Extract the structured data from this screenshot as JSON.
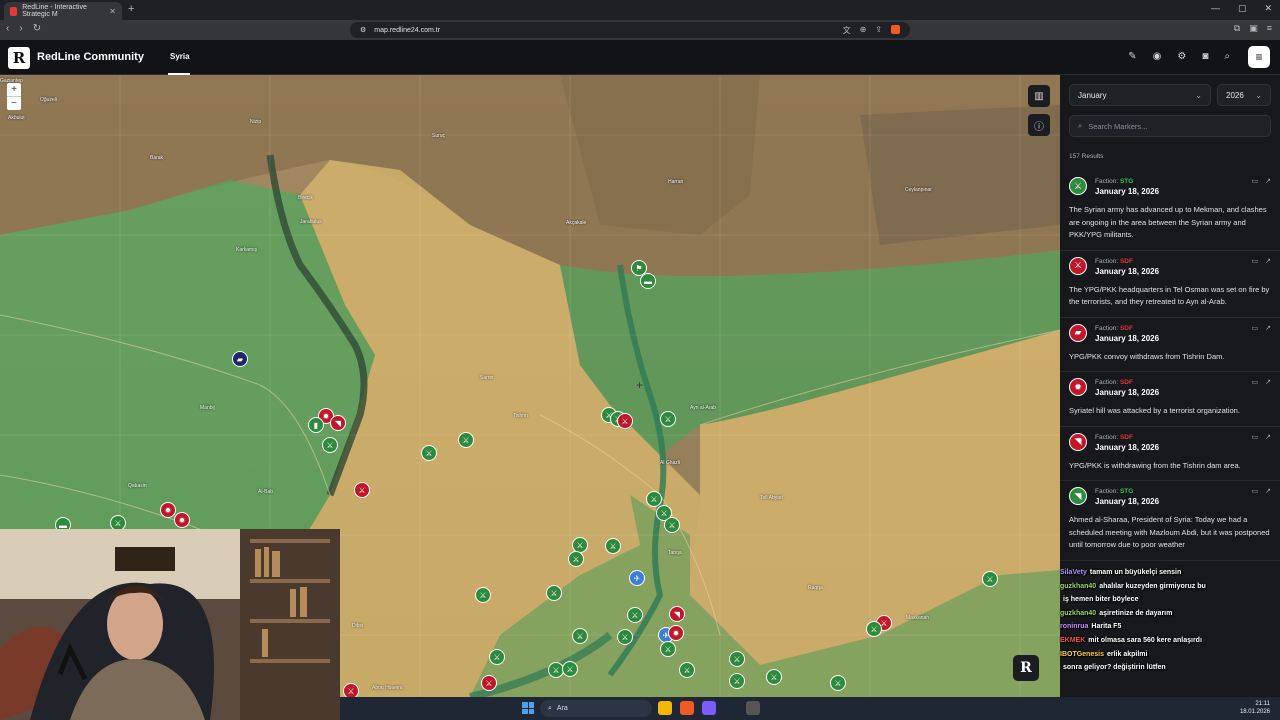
{
  "browser": {
    "tab_title": "RedLine - Interactive Strategic M",
    "url": "map.redline24.com.tr"
  },
  "header": {
    "brand": "RedLine Community",
    "logo_letter": "R",
    "active_tab": "Syria",
    "icons": [
      "tag-icon",
      "pin-icon",
      "gear-icon",
      "camera-icon",
      "search-icon",
      "menu-icon"
    ]
  },
  "map": {
    "zoom_in": "+",
    "zoom_out": "−",
    "places": [
      "Gaziantep",
      "Oğuzeli",
      "Akbulut",
      "Nizip",
      "Barak",
      "Karkamış",
      "Birecik",
      "Suruç",
      "Akçakale",
      "Harran",
      "Ceylanpınar",
      "Manbij",
      "Jarabulus",
      "Ayn al-Arab",
      "Al Ghazli",
      "Sarrin",
      "Tell Abyad",
      "Raqqa",
      "Tabqa",
      "Al-Bab",
      "Qabasin",
      "Tishrin",
      "Maskanah",
      "Dibsi",
      "Abou Houeira"
    ]
  },
  "sidebar": {
    "month": "January",
    "year": "2026",
    "search_placeholder": "Search Markers...",
    "results": "157 Results",
    "feed": [
      {
        "faction_label": "Faction:",
        "faction": "STG",
        "faction_color": "#3fbf57",
        "date": "January 18, 2026",
        "icon": "rifle-icon",
        "icon_bg": "#2e8b3e",
        "text": "The Syrian army has advanced up to Mekman, and clashes are ongoing in the area between the Syrian army and PKK/YPG militants."
      },
      {
        "faction_label": "Faction:",
        "faction": "SDF",
        "faction_color": "#e0303f",
        "date": "January 18, 2026",
        "icon": "rifle-icon",
        "icon_bg": "#c0182a",
        "text": "The YPG/PKK headquarters in Tel Osman was set on fire by the terrorists, and they retreated to Ayn al-Arab."
      },
      {
        "faction_label": "Faction:",
        "faction": "SDF",
        "faction_color": "#e0303f",
        "date": "January 18, 2026",
        "icon": "truck-icon",
        "icon_bg": "#c0182a",
        "text": "YPG/PKK convoy withdraws from Tishrin Dam."
      },
      {
        "faction_label": "Faction:",
        "faction": "SDF",
        "faction_color": "#e0303f",
        "date": "January 18, 2026",
        "icon": "explosion-icon",
        "icon_bg": "#c0182a",
        "text": "Syriatel hill was attacked by a terrorist organization."
      },
      {
        "faction_label": "Faction:",
        "faction": "SDF",
        "faction_color": "#e0303f",
        "date": "January 18, 2026",
        "icon": "megaphone-icon",
        "icon_bg": "#c0182a",
        "text": "YPG/PKK is withdrawing from the Tishrin dam area."
      },
      {
        "faction_label": "Faction:",
        "faction": "STG",
        "faction_color": "#3fbf57",
        "date": "January 18, 2026",
        "icon": "megaphone-icon",
        "icon_bg": "#2e8b3e",
        "text": "Ahmed al-Sharaa, President of Syria: Today we had a scheduled meeting with Mazloum Abdi, but it was postponed until tomorrow due to poor weather"
      }
    ]
  },
  "chat": [
    {
      "user": "SilaVety",
      "color": "#b38cff",
      "msg": "tamam un büyükelçi sensin"
    },
    {
      "user": "guzkhan40",
      "color": "#9ad36a",
      "msg": "ahalılar kuzeyden girmiyoruz bu"
    },
    {
      "user": "",
      "color": "#ffffff",
      "msg": "iş hemen biter böylece"
    },
    {
      "user": "guzkhan40",
      "color": "#9ad36a",
      "msg": "aşiretinize de dayarım"
    },
    {
      "user": "roninrua",
      "color": "#c98aff",
      "msg": "Harita F5"
    },
    {
      "user": "EKMEK",
      "color": "#ff4a4a",
      "msg": "mit olmasa sara 560 kere anlaşırdı"
    },
    {
      "user": "IBOTGenesis",
      "color": "#ffd24a",
      "msg": "erlik akpilmi"
    },
    {
      "user": "",
      "color": "#ffffff",
      "msg": "sonra geliyor? değiştirin lütfen"
    }
  ],
  "taskbar": {
    "search": "Ara",
    "time": "21:11",
    "date": "18.01.2026"
  }
}
